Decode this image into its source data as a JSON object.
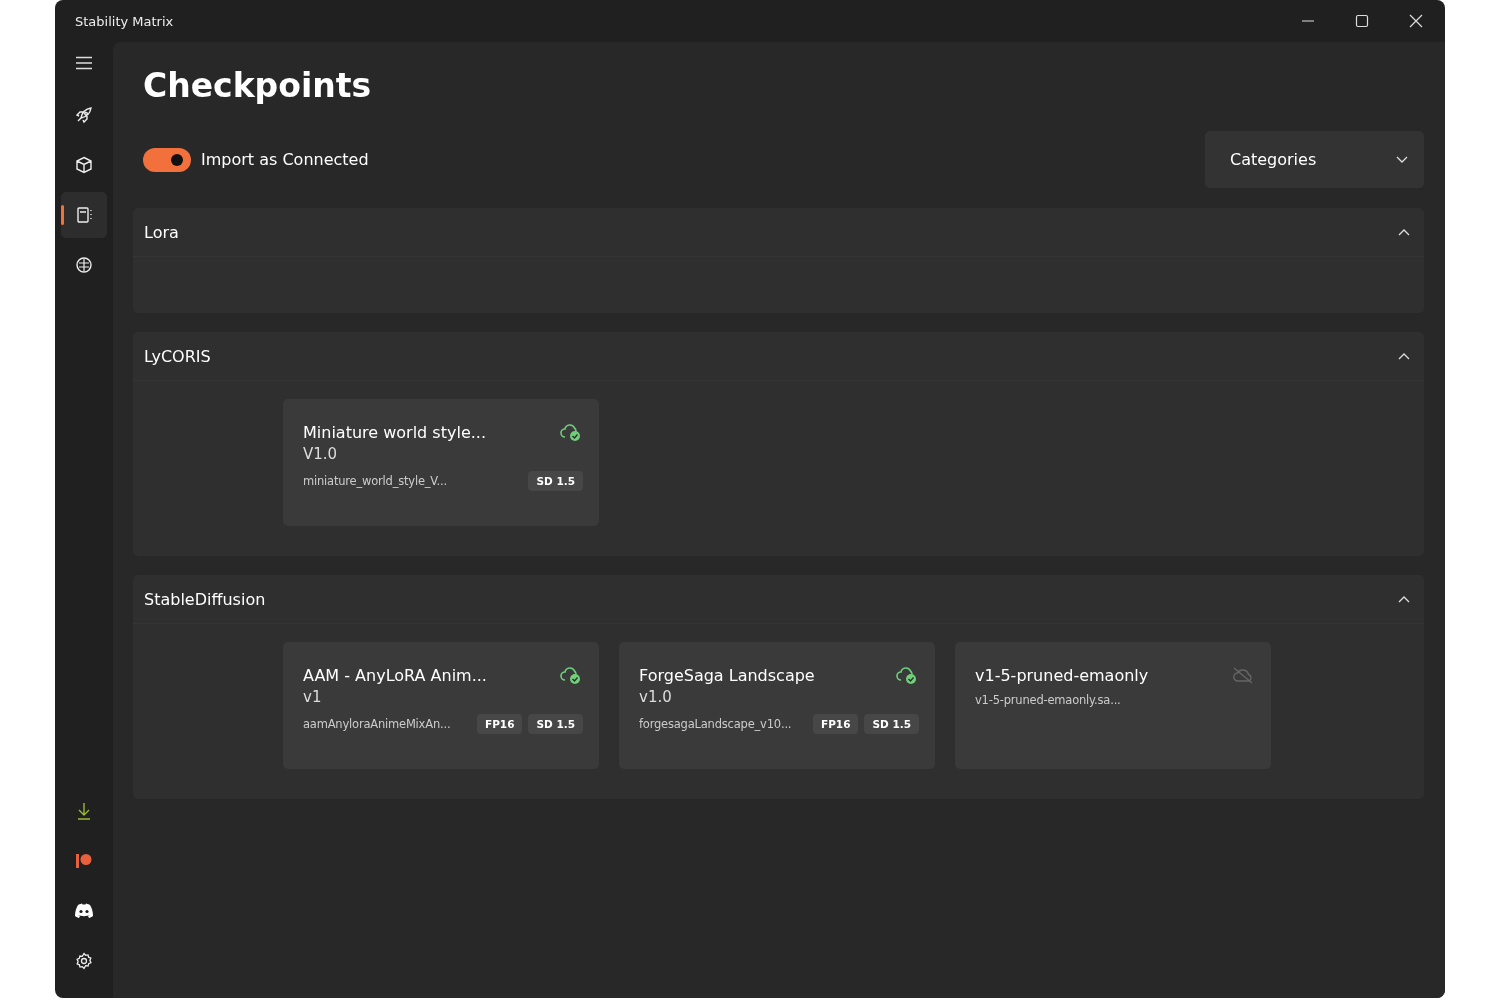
{
  "window": {
    "title": "Stability Matrix"
  },
  "sidebar": {
    "items": [
      {
        "kind": "rocket",
        "selected": false
      },
      {
        "kind": "box",
        "selected": false
      },
      {
        "kind": "checkpoints",
        "selected": true
      },
      {
        "kind": "brain",
        "selected": false
      }
    ],
    "bottom_items": [
      {
        "kind": "download"
      },
      {
        "kind": "patreon"
      },
      {
        "kind": "discord"
      },
      {
        "kind": "settings"
      }
    ]
  },
  "page": {
    "title": "Checkpoints",
    "import_toggle": {
      "label": "Import as Connected",
      "on": true
    },
    "categories": {
      "label": "Categories"
    }
  },
  "sections": [
    {
      "name": "Lora",
      "expanded": true
    },
    {
      "name": "LyCORIS",
      "expanded": true,
      "cards": [
        {
          "title": "Miniature world style...",
          "version": "V1.0",
          "file": "miniature_world_style_V...",
          "tags": [
            "SD 1.5"
          ],
          "connected": true
        }
      ]
    },
    {
      "name": "StableDiffusion",
      "expanded": true,
      "cards": [
        {
          "title": "AAM - AnyLoRA Anim...",
          "version": "v1",
          "file": "aamAnyloraAnimeMixAn...",
          "tags": [
            "FP16",
            "SD 1.5"
          ],
          "connected": true
        },
        {
          "title": "ForgeSaga Landscape",
          "version": "v1.0",
          "file": "forgesagaLandscape_v10...",
          "tags": [
            "FP16",
            "SD 1.5"
          ],
          "connected": true
        },
        {
          "title": "v1-5-pruned-emaonly",
          "file": "v1-5-pruned-emaonly.sa...",
          "connected": false
        }
      ]
    }
  ]
}
